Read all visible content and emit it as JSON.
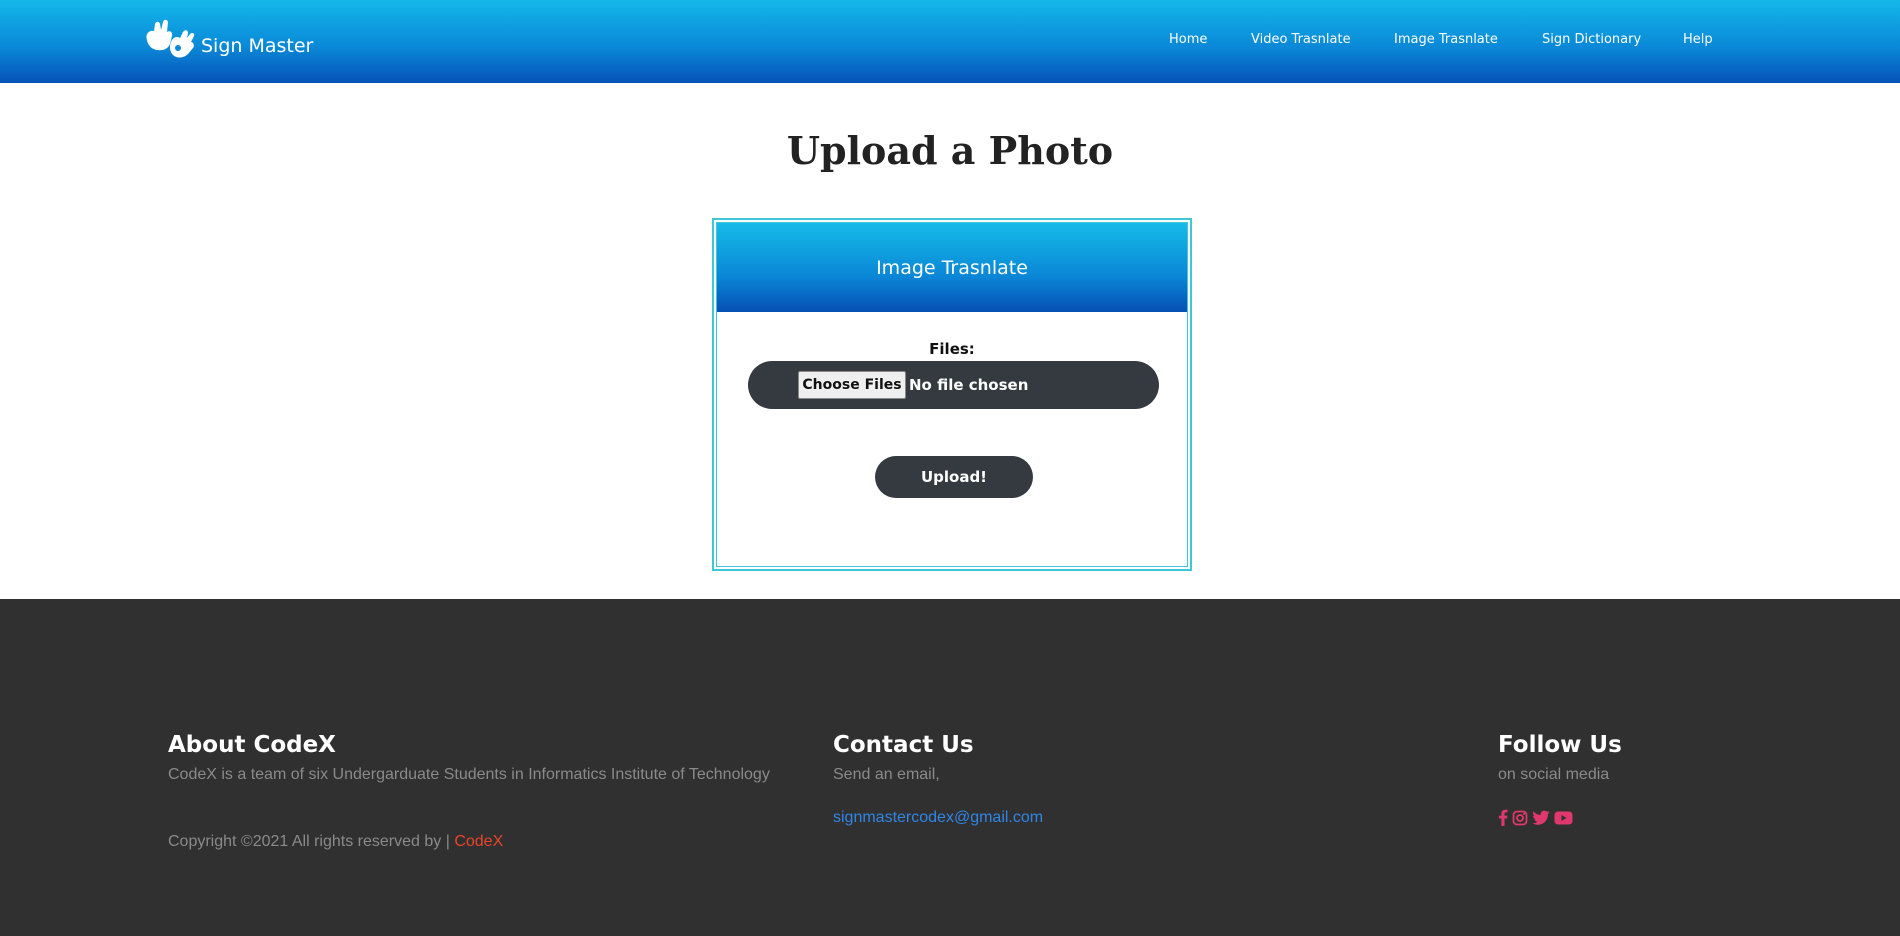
{
  "brand": {
    "name": "Sign Master"
  },
  "nav": {
    "items": [
      {
        "label": "Home"
      },
      {
        "label": "Video Trasnlate"
      },
      {
        "label": "Image Trasnlate"
      },
      {
        "label": "Sign Dictionary"
      },
      {
        "label": "Help"
      }
    ]
  },
  "main": {
    "title": "Upload a Photo",
    "card_title": "Image Trasnlate",
    "files_label": "Files:",
    "choose_files": "Choose Files",
    "no_file": "No file chosen",
    "upload_label": "Upload!"
  },
  "footer": {
    "about": {
      "title": "About CodeX",
      "text": "CodeX is a team of six Undergarduate Students in Informatics Institute of Technology"
    },
    "copyright": {
      "text": "Copyright ©2021 All rights reserved by | ",
      "link": "CodeX"
    },
    "contact": {
      "title": "Contact Us",
      "text": "Send an email,",
      "email": "signmastercodex@gmail.com"
    },
    "follow": {
      "title": "Follow Us",
      "text": "on social media",
      "icons": [
        "facebook-icon",
        "instagram-icon",
        "twitter-icon",
        "youtube-icon"
      ]
    }
  },
  "colors": {
    "header_gradient_top": "#14b8ea",
    "header_gradient_bottom": "#0752b8",
    "card_border": "#3ec7d8",
    "pill_dark": "#343a40",
    "footer_bg": "#303030",
    "email_link": "#2f86e6",
    "codex_link": "#e8452a",
    "social_icon": "#e0386e"
  }
}
